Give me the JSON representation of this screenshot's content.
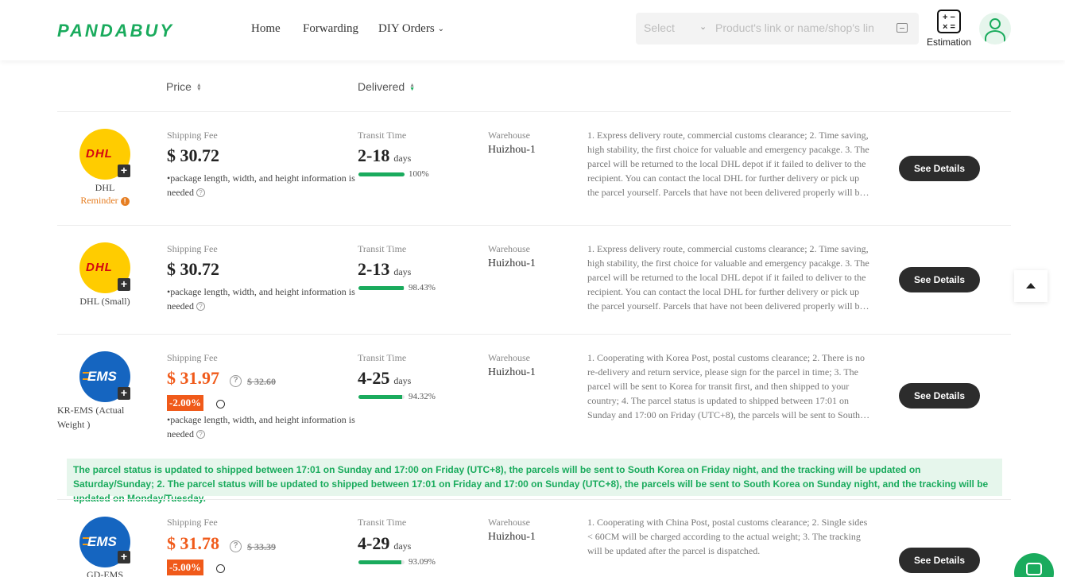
{
  "header": {
    "logo": "PANDABUY",
    "nav": {
      "home": "Home",
      "forwarding": "Forwarding",
      "diy": "DIY Orders"
    },
    "search": {
      "select": "Select",
      "placeholder": "Product's link or name/shop's link"
    },
    "estimation": "Estimation"
  },
  "sort": {
    "price": "Price",
    "delivered": "Delivered"
  },
  "labels": {
    "shipping_fee": "Shipping Fee",
    "transit_time": "Transit Time",
    "warehouse": "Warehouse",
    "days": "days",
    "see_details": "See Details",
    "size_note": "•package length, width, and height information is needed"
  },
  "colors": {
    "brand": "#1aab5d",
    "discount": "#f05a1a",
    "button": "#2c2c2c"
  },
  "routes": [
    {
      "carrier": "DHL",
      "reminder": "Reminder",
      "logo_text": "DHL",
      "fee": "$ 30.72",
      "transit": "2-18",
      "delivered_pct": "100%",
      "delivered_value": 100,
      "warehouse": "Huizhou-1",
      "description": "1. Express delivery route, commercial customs clearance; 2. Time saving, high stability, the first choice for valuable and emergency pacakge. 3. The parcel will be returned to the local DHL depot if it failed to deliver to the recipient. You can contact the local DHL for further delivery or pick up the parcel yourself. Parcels that have not been delivered properly will be returned."
    },
    {
      "carrier": "DHL (Small)",
      "logo_text": "DHL",
      "fee": "$ 30.72",
      "transit": "2-13",
      "delivered_pct": "98.43%",
      "delivered_value": 98.43,
      "warehouse": "Huizhou-1",
      "description": "1. Express delivery route, commercial customs clearance; 2. Time saving, high stability, the first choice for valuable and emergency pacakge. 3. The parcel will be returned to the local DHL depot if it failed to deliver to the recipient. You can contact the local DHL for further delivery or pick up the parcel yourself. Parcels that have not been delivered properly will be returned."
    },
    {
      "carrier": "KR-EMS (Actual Weight )",
      "logo_text": "EMS",
      "fee": "$ 31.97",
      "original_fee": "$ 32.60",
      "discount": "-2.00%",
      "transit": "4-25",
      "delivered_pct": "94.32%",
      "delivered_value": 94.32,
      "warehouse": "Huizhou-1",
      "description": "1. Cooperating with Korea Post, postal customs clearance; 2. There is no re-delivery and return service, please sign for the parcel in time; 3. The parcel will be sent to Korea for transit first, and then shipped to your country; 4. The parcel status is updated to shipped between 17:01 on Sunday and 17:00 on Friday (UTC+8), the parcels will be sent to South Korea."
    },
    {
      "carrier": "GD-EMS",
      "logo_text": "EMS",
      "fee": "$ 31.78",
      "original_fee": "$ 33.39",
      "discount": "-5.00%",
      "transit": "4-29",
      "delivered_pct": "93.09%",
      "delivered_value": 93.09,
      "warehouse": "Huizhou-1",
      "description": "1. Cooperating with China Post, postal customs clearance; 2. Single sides < 60CM will be charged according to the actual weight; 3. The tracking will be updated after the parcel is dispatched."
    }
  ],
  "notice": "The parcel status is updated to shipped between 17:01 on Sunday and 17:00 on Friday (UTC+8), the parcels will be sent to South Korea on Friday night, and the tracking will be updated on Saturday/Sunday; 2. The parcel status will be updated to shipped between 17:01 on Friday and 17:00 on Sunday (UTC+8), the parcels will be sent to South Korea on Sunday night, and the tracking will be updated on Monday/Tuesday."
}
